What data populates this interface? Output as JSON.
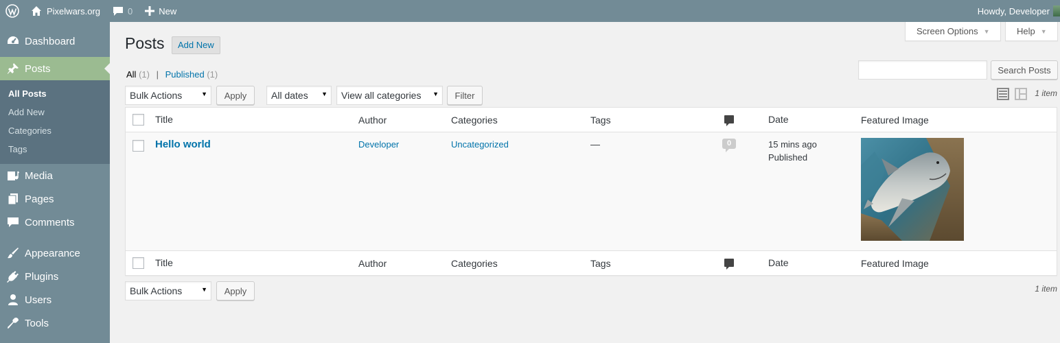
{
  "adminbar": {
    "site_name": "Pixelwars.org",
    "comments_count": "0",
    "new_label": "New",
    "howdy": "Howdy, Developer"
  },
  "sidebar": {
    "items": [
      {
        "label": "Dashboard",
        "icon": "dashboard-icon"
      },
      {
        "label": "Posts",
        "icon": "pin-icon"
      },
      {
        "label": "Media",
        "icon": "media-icon"
      },
      {
        "label": "Pages",
        "icon": "pages-icon"
      },
      {
        "label": "Comments",
        "icon": "comment-icon"
      },
      {
        "label": "Appearance",
        "icon": "brush-icon"
      },
      {
        "label": "Plugins",
        "icon": "plug-icon"
      },
      {
        "label": "Users",
        "icon": "user-icon"
      },
      {
        "label": "Tools",
        "icon": "wrench-icon"
      }
    ],
    "posts_submenu": [
      "All Posts",
      "Add New",
      "Categories",
      "Tags"
    ]
  },
  "screen_meta": {
    "screen_options": "Screen Options",
    "help": "Help"
  },
  "page": {
    "title": "Posts",
    "add_new": "Add New"
  },
  "views": {
    "all": "All",
    "all_count": "(1)",
    "sep": "|",
    "published": "Published",
    "published_count": "(1)"
  },
  "search": {
    "placeholder": "",
    "button": "Search Posts"
  },
  "tablenav": {
    "bulk_actions": "Bulk Actions",
    "apply": "Apply",
    "dates": "All dates",
    "categories": "View all categories",
    "filter": "Filter",
    "items_count": "1 item"
  },
  "table": {
    "columns": [
      "Title",
      "Author",
      "Categories",
      "Tags",
      "Date",
      "Featured Image"
    ],
    "rows": [
      {
        "title": "Hello world",
        "author": "Developer",
        "categories": "Uncategorized",
        "tags": "—",
        "comments": "0",
        "date_ago": "15 mins ago",
        "status": "Published"
      }
    ]
  },
  "colors": {
    "admin_bar": "#728b96",
    "active_menu": "#9bbb91",
    "link": "#0073aa"
  }
}
